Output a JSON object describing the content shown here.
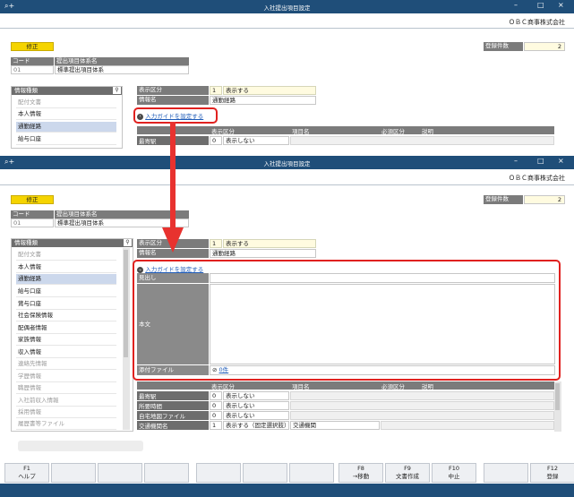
{
  "window": {
    "title": "入社提出項目設定",
    "company": "ＯＢＣ商事株式会社"
  },
  "badge": {
    "mode": "修正",
    "count_label": "登録件数",
    "count_value": "2"
  },
  "code_table": {
    "col_code": "コード",
    "col_name": "提出項目体系名",
    "code": "01",
    "name": "標準提出項目体系"
  },
  "info_panel": {
    "title": "情報種類",
    "items": [
      "配付文書",
      "本人情報",
      "通勤経路",
      "給与口座",
      "賞与口座",
      "社会保険情報",
      "配偶者情報",
      "家族情報",
      "収入情報",
      "連絡先情報",
      "学歴情報",
      "職歴情報",
      "入社前収入情報",
      "採用情報",
      "履歴書等ファイル"
    ]
  },
  "fields": {
    "display_label": "表示区分",
    "display_num": "1",
    "display_value": "表示する",
    "name_label": "情報名",
    "name_value": "通勤経路"
  },
  "guide": {
    "link": "入力ガイドを設定する",
    "heading_label": "見出し",
    "body_label": "本文",
    "attach_label": "添付ファイル",
    "attach_count": "0件"
  },
  "table": {
    "headers": [
      "表示区分",
      "項目名",
      "必須区分",
      "説明"
    ],
    "rows": [
      {
        "name": "最寄駅",
        "num": "0",
        "display": "表示しない",
        "item": ""
      },
      {
        "name": "所要時間",
        "num": "0",
        "display": "表示しない",
        "item": ""
      },
      {
        "name": "自宅地図ファイル",
        "num": "0",
        "display": "表示しない",
        "item": ""
      },
      {
        "name": "交通機関名",
        "num": "1",
        "display": "表示する（固定選択肢）",
        "item": "交通機関"
      }
    ]
  },
  "fkeys": [
    {
      "key": "F1",
      "label": "ヘルプ"
    },
    {
      "key": "",
      "label": ""
    },
    {
      "key": "",
      "label": ""
    },
    {
      "key": "",
      "label": ""
    },
    {
      "key": "",
      "label": ""
    },
    {
      "key": "",
      "label": ""
    },
    {
      "key": "",
      "label": ""
    },
    {
      "key": "F8",
      "label": "→移動"
    },
    {
      "key": "F9",
      "label": "文書作成"
    },
    {
      "key": "F10",
      "label": "中止"
    },
    {
      "key": "",
      "label": ""
    },
    {
      "key": "F12",
      "label": "登録"
    }
  ],
  "colors": {
    "titlebar": "#1f4e79",
    "highlight": "#e0211f",
    "accent_yellow": "#f5d400",
    "link": "#1e5bb8"
  },
  "icons": [
    "app-icon",
    "minimize-icon",
    "maximize-icon",
    "close-icon",
    "search-icon",
    "guide-arrow-icon",
    "paperclip-icon",
    "red-arrow-icon"
  ]
}
